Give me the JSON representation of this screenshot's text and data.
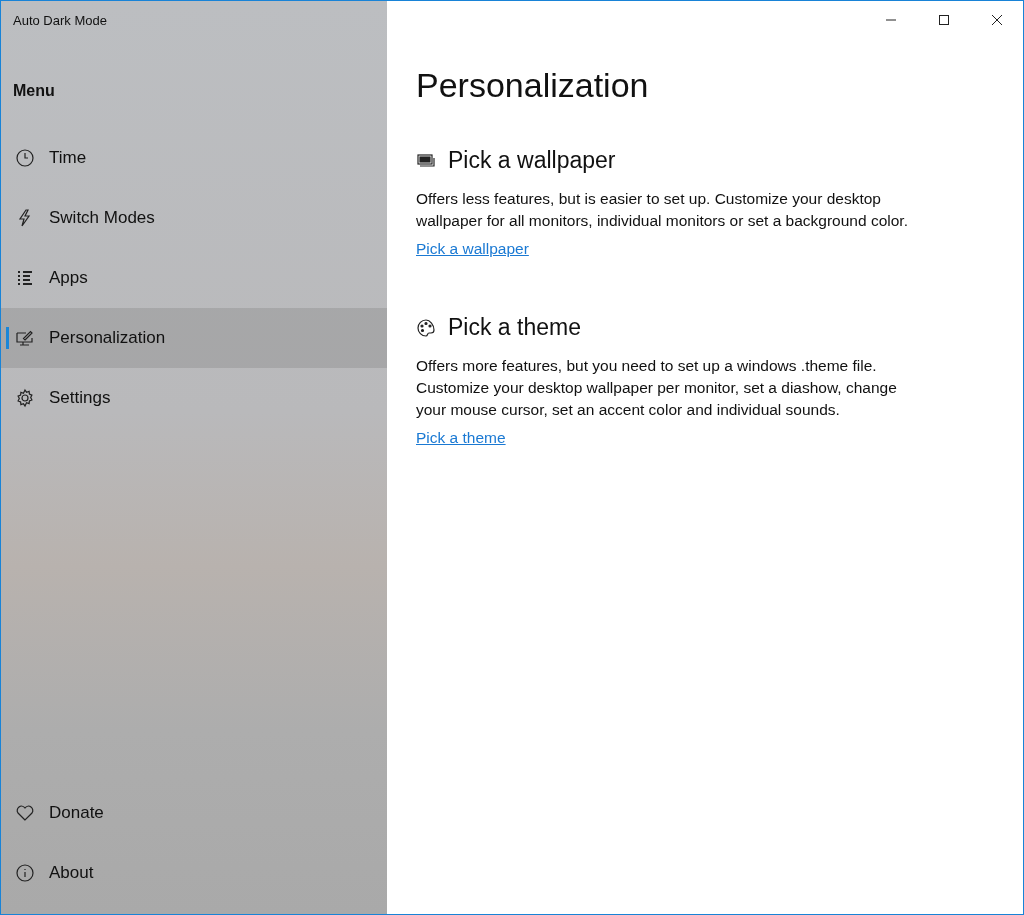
{
  "app_title": "Auto Dark Mode",
  "menu_heading": "Menu",
  "nav_items": [
    {
      "label": "Time",
      "selected": false
    },
    {
      "label": "Switch Modes",
      "selected": false
    },
    {
      "label": "Apps",
      "selected": false
    },
    {
      "label": "Personalization",
      "selected": true
    },
    {
      "label": "Settings",
      "selected": false
    }
  ],
  "footer_items": [
    {
      "label": "Donate"
    },
    {
      "label": "About"
    }
  ],
  "page_title": "Personalization",
  "sections": [
    {
      "heading": "Pick a wallpaper",
      "description": "Offers less features, but is easier to set up. Customize your desktop wallpaper for all monitors, individual monitors or set a background color.",
      "link": "Pick a wallpaper"
    },
    {
      "heading": "Pick a theme",
      "description": "Offers more features, but you need to set up a windows .theme file. Customize your desktop wallpaper per monitor, set a diashow, change your mouse cursor, set an accent color and individual sounds.",
      "link": "Pick a theme"
    }
  ]
}
